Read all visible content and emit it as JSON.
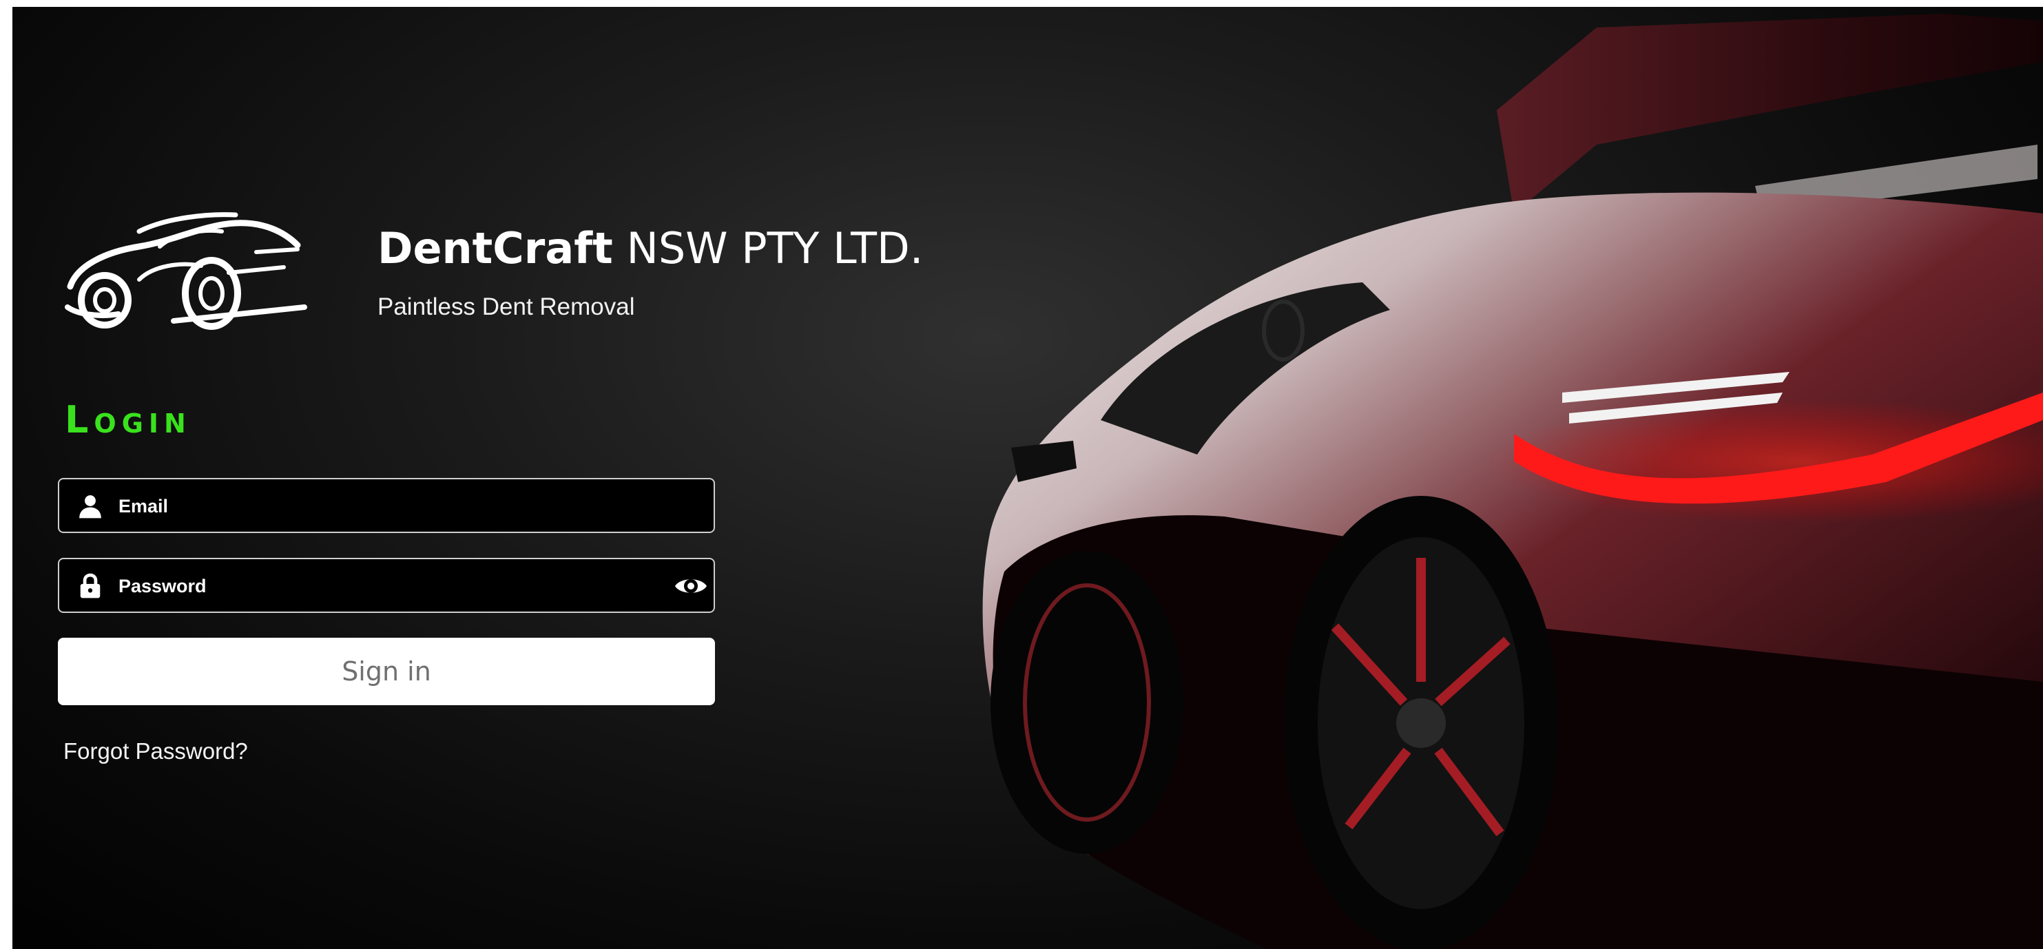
{
  "brand": {
    "name_bold": "DentCraft",
    "name_rest": "NSW PTY LTD.",
    "tagline": "Paintless Dent Removal",
    "logo_icon": "car-logo-icon"
  },
  "login": {
    "title": "Login",
    "email_placeholder": "Email",
    "password_placeholder": "Password",
    "signin_label": "Sign in",
    "forgot_label": "Forgot Password?"
  },
  "icons": {
    "email": "user-icon",
    "password": "lock-icon",
    "toggle": "eye-icon"
  },
  "colors": {
    "accent_green": "#39e21d",
    "tail_light_red": "#ff1a1a",
    "background": "#111111"
  }
}
